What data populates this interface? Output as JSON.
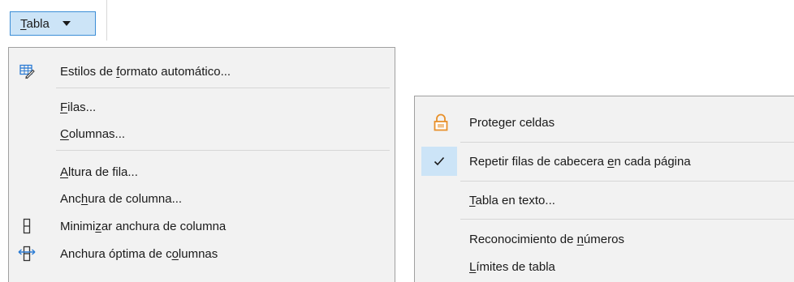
{
  "menubar": {
    "tabla_menu": {
      "label_parts": [
        "",
        "T",
        "abla"
      ]
    }
  },
  "left_menu": {
    "items": [
      {
        "icon": "autoformat-styles-icon",
        "parts": [
          "Estilos de ",
          "f",
          "ormato automático..."
        ]
      },
      {
        "icon": "",
        "parts": [
          "",
          "F",
          "ilas..."
        ]
      },
      {
        "icon": "",
        "parts": [
          "",
          "C",
          "olumnas..."
        ]
      },
      {
        "icon": "",
        "parts": [
          "",
          "A",
          "ltura de fila..."
        ]
      },
      {
        "icon": "",
        "parts": [
          "Anc",
          "h",
          "ura de columna..."
        ]
      },
      {
        "icon": "minimize-column-width-icon",
        "parts": [
          "Minimi",
          "z",
          "ar anchura de columna"
        ]
      },
      {
        "icon": "optimal-column-width-icon",
        "parts": [
          "Anchura óptima de c",
          "o",
          "lumnas"
        ]
      }
    ]
  },
  "right_menu": {
    "items": [
      {
        "icon": "protect-cells-lock-icon",
        "parts": [
          "Prote",
          "g",
          "er celdas"
        ],
        "checked": false
      },
      {
        "icon": "check-icon",
        "parts": [
          "Repetir filas de cabecera ",
          "e",
          "n cada página"
        ],
        "checked": true
      },
      {
        "icon": "",
        "parts": [
          "",
          "T",
          "abla en texto..."
        ],
        "checked": false
      },
      {
        "icon": "",
        "parts": [
          "Reconocimiento de ",
          "n",
          "úmeros"
        ],
        "checked": false
      },
      {
        "icon": "",
        "parts": [
          "",
          "L",
          "ímites de tabla"
        ],
        "checked": false
      }
    ]
  },
  "colors": {
    "accent": "#3c8ed6",
    "highlight": "#cce4f7",
    "lock_orange": "#e8902a",
    "icon_blue": "#2a7bd4"
  }
}
